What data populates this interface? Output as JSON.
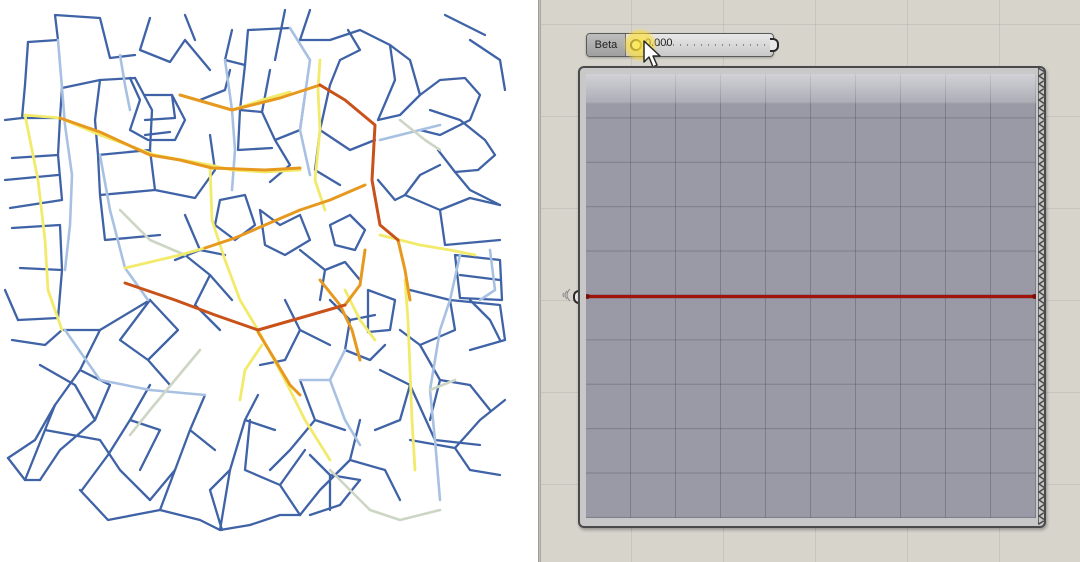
{
  "map": {
    "colors": {
      "blue": "#3f63a6",
      "light_blue": "#a8c1e2",
      "pale": "#cdd6c4",
      "yellow": "#f2ea6a",
      "orange": "#e6991e",
      "red": "#c8521a"
    }
  },
  "slider": {
    "name": "Beta",
    "value": "0.000",
    "fraction": 0
  },
  "graph": {
    "line_color": "#a1140c",
    "line_level": 0.5
  },
  "canvas": {
    "background": "#d7d4cc"
  }
}
